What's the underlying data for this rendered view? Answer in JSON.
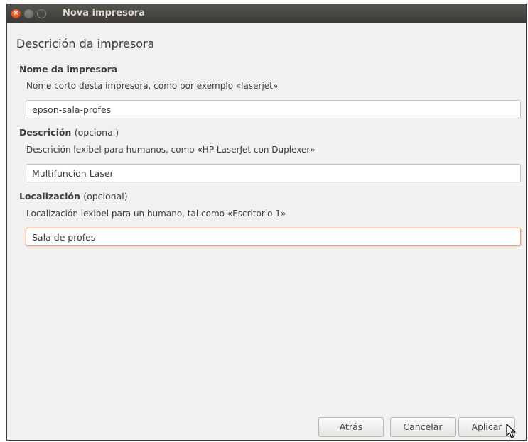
{
  "window": {
    "title": "Nova impresora",
    "close_symbol": "×"
  },
  "page_title": "Descrición da impresora",
  "fields": {
    "name": {
      "label": "Nome da impresora",
      "description": "Nome corto desta impresora, como por exemplo «laserjet»",
      "value": "epson-sala-profes"
    },
    "description": {
      "label": "Descrición",
      "optional": "(opcional)",
      "description": "Descrición lexibel para humanos, como «HP LaserJet con Duplexer»",
      "value": "Multifuncion Laser"
    },
    "location": {
      "label": "Localización",
      "optional": "(opcional)",
      "description": "Localización lexibel para un humano, tal como «Escritorio 1»",
      "value": "Sala de profes"
    }
  },
  "buttons": {
    "back": "Atrás",
    "cancel": "Cancelar",
    "apply": "Aplicar"
  }
}
